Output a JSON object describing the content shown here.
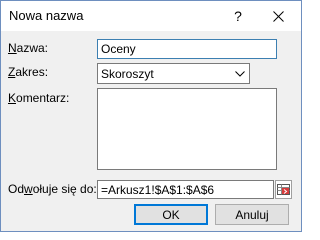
{
  "dialog": {
    "title": "Nowa nazwa",
    "help_glyph": "?"
  },
  "form": {
    "name_label_mnemonic": "N",
    "name_label_rest": "azwa:",
    "name_value": "Oceny",
    "scope_label_mnemonic": "Z",
    "scope_label_rest": "akres:",
    "scope_value": "Skoroszyt",
    "comment_label_mnemonic": "K",
    "comment_label_rest": "omentarz:",
    "comment_value": "",
    "refers_label_pre": "Od",
    "refers_label_mnemonic": "w",
    "refers_label_post": "ołuje się do:",
    "refers_value": "=Arkusz1!$A$1:$A$6"
  },
  "buttons": {
    "ok": "OK",
    "cancel": "Anuluj"
  },
  "icons": {
    "close": "close-icon",
    "chevron": "chevron-down-icon",
    "range_picker": "range-select-icon"
  },
  "colors": {
    "accent": "#0078d7",
    "dialog_bg": "#f0f0f0"
  }
}
